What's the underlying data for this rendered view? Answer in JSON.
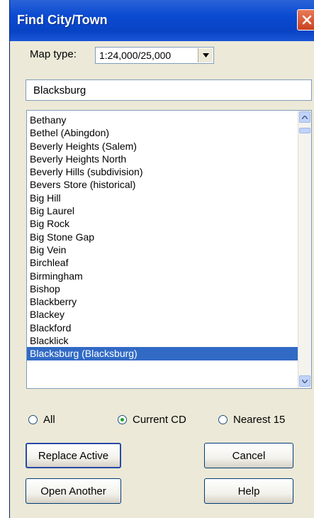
{
  "window": {
    "title": "Find City/Town"
  },
  "map_type": {
    "label": "Map type:",
    "selected": "1:24,000/25,000"
  },
  "search": {
    "value": "Blacksburg"
  },
  "list": {
    "items": [
      "Bethany",
      "Bethel (Abingdon)",
      "Beverly Heights (Salem)",
      "Beverly Heights North",
      "Beverly Hills (subdivision)",
      "Bevers Store (historical)",
      "Big Hill",
      "Big Laurel",
      "Big Rock",
      "Big Stone Gap",
      "Big Vein",
      "Birchleaf",
      "Birmingham",
      "Bishop",
      "Blackberry",
      "Blackey",
      "Blackford",
      "Blacklick",
      "Blacksburg (Blacksburg)"
    ],
    "selected_item": "Blacksburg (Blacksburg)"
  },
  "filter": {
    "options": [
      {
        "label": "All",
        "checked": false
      },
      {
        "label": "Current CD",
        "checked": true
      },
      {
        "label": "Nearest 15",
        "checked": false
      }
    ]
  },
  "buttons": {
    "replace_active": "Replace Active",
    "cancel": "Cancel",
    "open_another": "Open Another",
    "help": "Help"
  }
}
